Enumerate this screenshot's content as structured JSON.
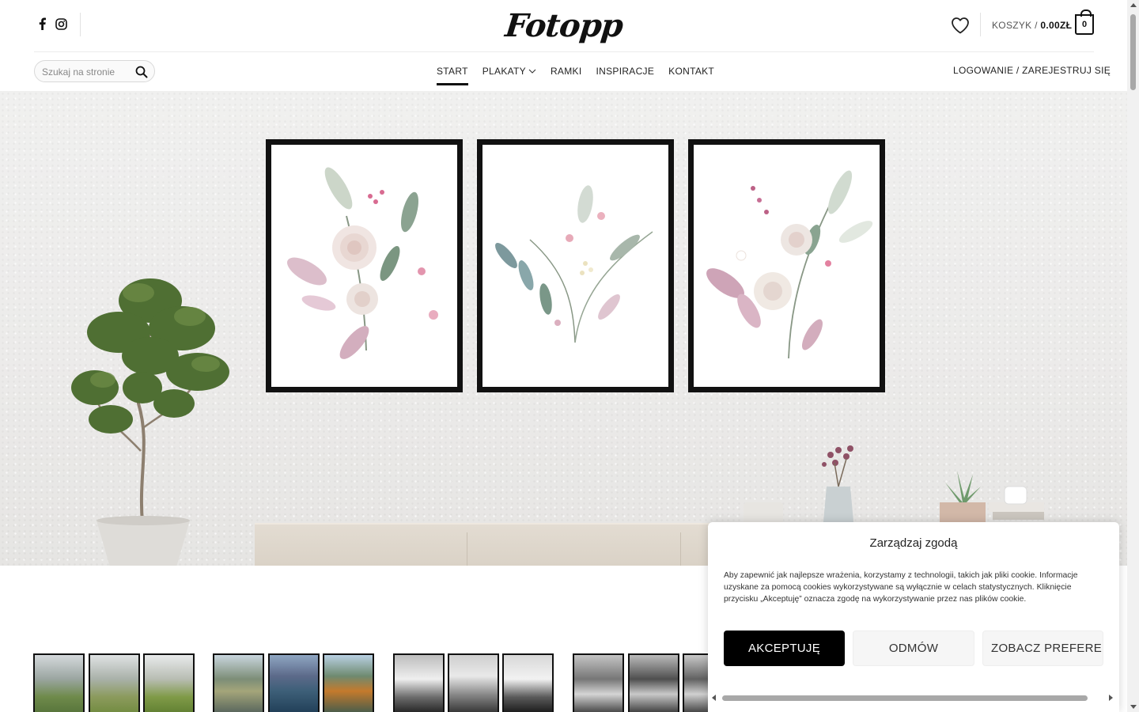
{
  "brand": {
    "logo_text": "Fotopp"
  },
  "header": {
    "social": [
      {
        "icon": "facebook-icon"
      },
      {
        "icon": "instagram-icon"
      }
    ],
    "cart": {
      "label": "KOSZYK / ",
      "amount": "0.00ZŁ",
      "count": "0"
    },
    "search": {
      "placeholder": "Szukaj na stronie"
    },
    "nav": [
      {
        "label": "START",
        "active": true
      },
      {
        "label": "PLAKATY",
        "dropdown": true
      },
      {
        "label": "RAMKI"
      },
      {
        "label": "INSPIRACJE"
      },
      {
        "label": "KONTAKT"
      }
    ],
    "login": "LOGOWANIE / ZAREJESTRUJ SIĘ"
  },
  "hero": {
    "frames": 3,
    "theme": "botanical watercolor prints"
  },
  "cookie": {
    "title": "Zarządzaj zgodą",
    "text": "Aby zapewnić jak najlepsze wrażenia, korzystamy z technologii, takich jak pliki cookie. Informacje uzyskane za pomocą cookies wykorzystywane są wyłącznie w celach statystycznych. Kliknięcie przycisku „Akceptuję” oznacza zgodę na wykorzystywanie przez nas plików cookie.",
    "accept": "AKCEPTUJĘ",
    "deny": "ODMÓW",
    "preferences": "ZOBACZ PREFERENCJE"
  },
  "colors": {
    "accent": "#000000",
    "text": "#222222",
    "hero_bg": "#ecebea"
  }
}
